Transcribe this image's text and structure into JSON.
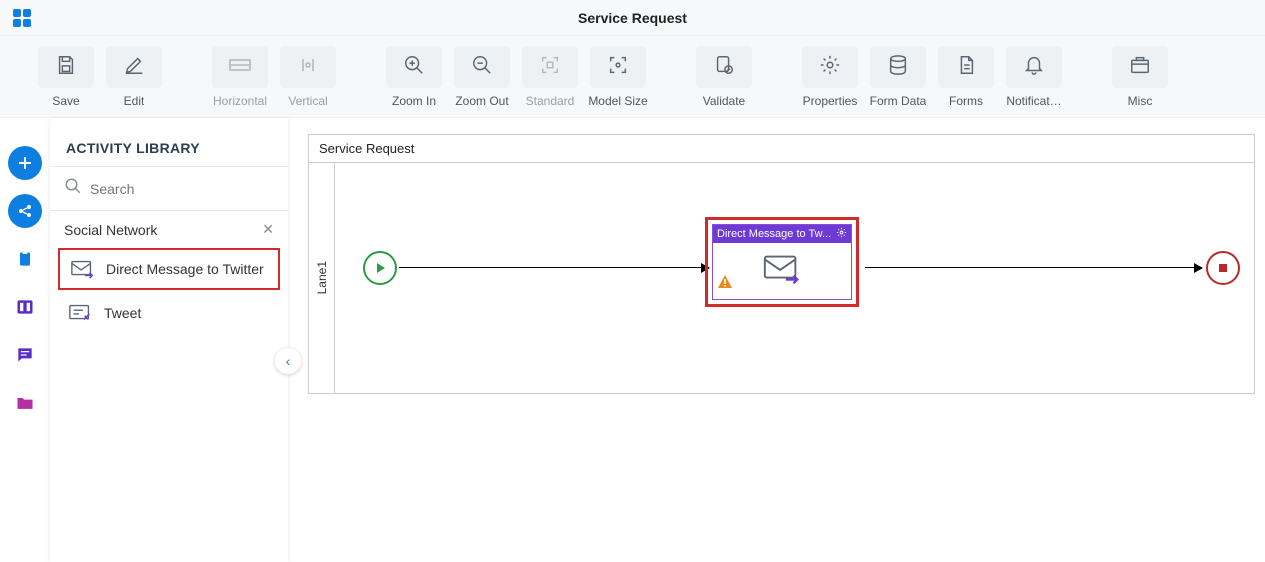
{
  "header": {
    "title": "Service Request"
  },
  "toolbar": {
    "save": "Save",
    "edit": "Edit",
    "horizontal": "Horizontal",
    "vertical": "Vertical",
    "zoom_in": "Zoom In",
    "zoom_out": "Zoom Out",
    "standard": "Standard",
    "model_size": "Model Size",
    "validate": "Validate",
    "properties": "Properties",
    "form_data": "Form Data",
    "forms": "Forms",
    "notifications": "Notificat…",
    "misc": "Misc"
  },
  "sidebar": {
    "title": "ACTIVITY LIBRARY",
    "search_placeholder": "Search",
    "group": "Social Network",
    "items": [
      {
        "label": "Direct Message to Twitter"
      },
      {
        "label": "Tweet"
      }
    ]
  },
  "canvas": {
    "process_name": "Service Request",
    "lane_name": "Lane1",
    "shape_title": "Direct Message to Tw..."
  },
  "colors": {
    "accent": "#0e7fe1",
    "highlight": "#d12c2c",
    "purple": "#6d3ad6",
    "start": "#2e9a47",
    "end": "#b62a2a",
    "rail_purple": "#5b2bc7"
  }
}
